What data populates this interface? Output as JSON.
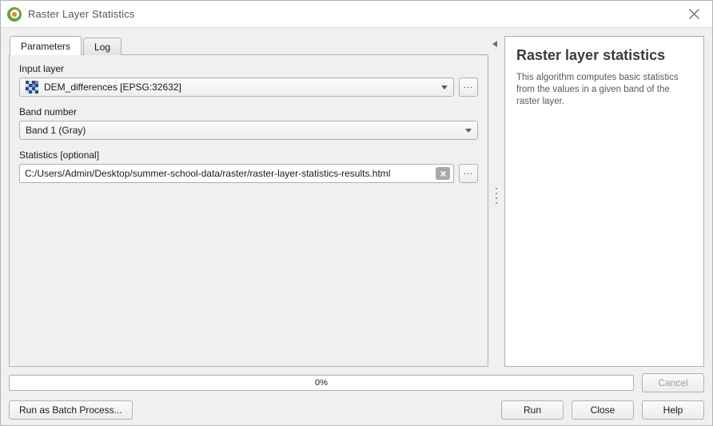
{
  "window": {
    "title": "Raster Layer Statistics",
    "logo_icon": "qgis-logo-icon",
    "close_icon": "close-icon"
  },
  "tabs": [
    {
      "label": "Parameters",
      "active": true
    },
    {
      "label": "Log",
      "active": false
    }
  ],
  "parameters": {
    "input_layer": {
      "label": "Input layer",
      "value": "DEM_differences [EPSG:32632]",
      "layer_icon": "raster-layer-icon",
      "dropdown_icon": "chevron-down-icon",
      "browse_label": "..."
    },
    "band_number": {
      "label": "Band number",
      "value": "Band 1 (Gray)",
      "dropdown_icon": "chevron-down-icon"
    },
    "statistics": {
      "label": "Statistics [optional]",
      "value": "C:/Users/Admin/Desktop/summer-school-data/raster/raster-layer-statistics-results.html",
      "clear_icon": "clear-x-icon",
      "browse_label": "..."
    }
  },
  "splitter": {
    "collapse_icon": "collapse-left-arrow-icon",
    "grip_icon": "splitter-grip-icon"
  },
  "help": {
    "title": "Raster layer statistics",
    "description": "This algorithm computes basic statistics from the values in a given band of the raster layer."
  },
  "progress": {
    "percent_label": "0%",
    "value": 0
  },
  "buttons": {
    "cancel": "Cancel",
    "run_as_batch": "Run as Batch Process...",
    "run": "Run",
    "close": "Close",
    "help": "Help"
  },
  "colors": {
    "accent_green": "#6aa33c",
    "accent_orange": "#e8822a",
    "dialog_bg": "#f0f0f0",
    "panel_bg": "#ffffff",
    "border": "#b0b0b0"
  }
}
